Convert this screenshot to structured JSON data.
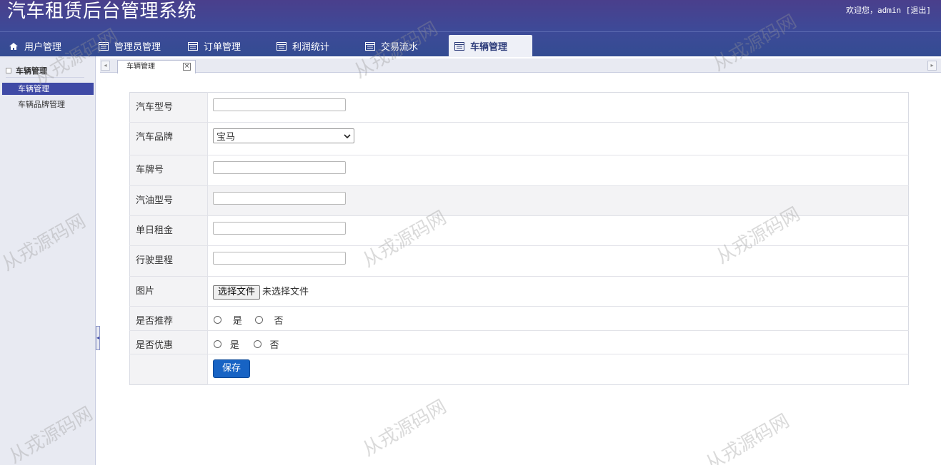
{
  "app": {
    "title": "汽车租赁后台管理系统",
    "welcome": "欢迎您，admin",
    "logout": "[退出]"
  },
  "nav": [
    {
      "label": "用户管理",
      "icon": "home-icon"
    },
    {
      "label": "管理员管理",
      "icon": "table-icon"
    },
    {
      "label": "订单管理",
      "icon": "table-icon"
    },
    {
      "label": "利润统计",
      "icon": "table-icon"
    },
    {
      "label": "交易流水",
      "icon": "table-icon"
    },
    {
      "label": "车辆管理",
      "icon": "table-icon",
      "active": true
    }
  ],
  "sidebar": {
    "heading": "车辆管理",
    "items": [
      {
        "label": "车辆管理",
        "active": true
      },
      {
        "label": "车辆品牌管理",
        "active": false
      }
    ]
  },
  "tabs": [
    {
      "label": "车辆管理",
      "close": "×"
    }
  ],
  "form": {
    "car_model_label": "汽车型号",
    "brand_label": "汽车品牌",
    "brand_value": "宝马",
    "plate_label": "车牌号",
    "fuel_label": "汽油型号",
    "daily_rent_label": "单日租金",
    "mileage_label": "行驶里程",
    "image_label": "图片",
    "file_button": "选择文件",
    "file_status": "未选择文件",
    "recommend_label": "是否推荐",
    "discount_label": "是否优惠",
    "yes": "是",
    "no": "否",
    "save": "保存"
  },
  "watermark": "从戎源码网"
}
